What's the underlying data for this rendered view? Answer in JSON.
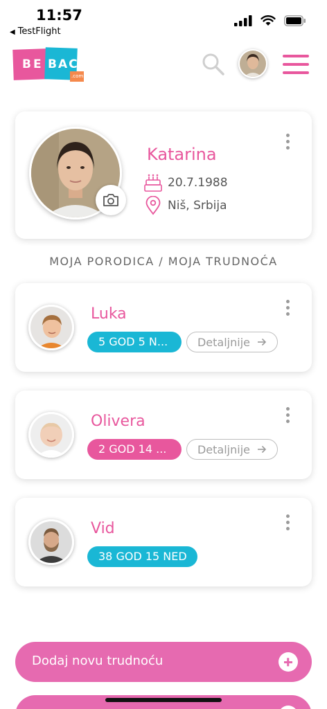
{
  "status_bar": {
    "time": "11:57",
    "back_app": "TestFlight"
  },
  "header": {
    "logo": {
      "part1": "BE",
      "part2": "BAC",
      "part3": ".com"
    },
    "icons": {
      "search": "search-icon",
      "menu": "hamburger-menu-icon"
    }
  },
  "profile": {
    "name": "Katarina",
    "birthdate": "20.7.1988",
    "location": "Niš, Srbija",
    "icons": {
      "birthday": "cake-icon",
      "location": "location-pin-icon",
      "camera": "camera-icon"
    }
  },
  "section_title": "MOJA PORODICA / MOJA TRUDNOĆA",
  "family": [
    {
      "name": "Luka",
      "age": "5 GOD 5 N...",
      "details": "Detaljnije",
      "badge_color": "#1ab7d5"
    },
    {
      "name": "Olivera",
      "age": "2 GOD 14 ...",
      "details": "Detaljnije",
      "badge_color": "#e8579d"
    },
    {
      "name": "Vid",
      "age": "38 GOD 15 NED",
      "badge_color": "#1ab7d5"
    }
  ],
  "buttons": {
    "add_pregnancy": "Dodaj novu trudnoću"
  },
  "colors": {
    "primary_pink": "#e8579d",
    "accent_cyan": "#1ab7d5",
    "button_pink": "#e66ab0"
  }
}
